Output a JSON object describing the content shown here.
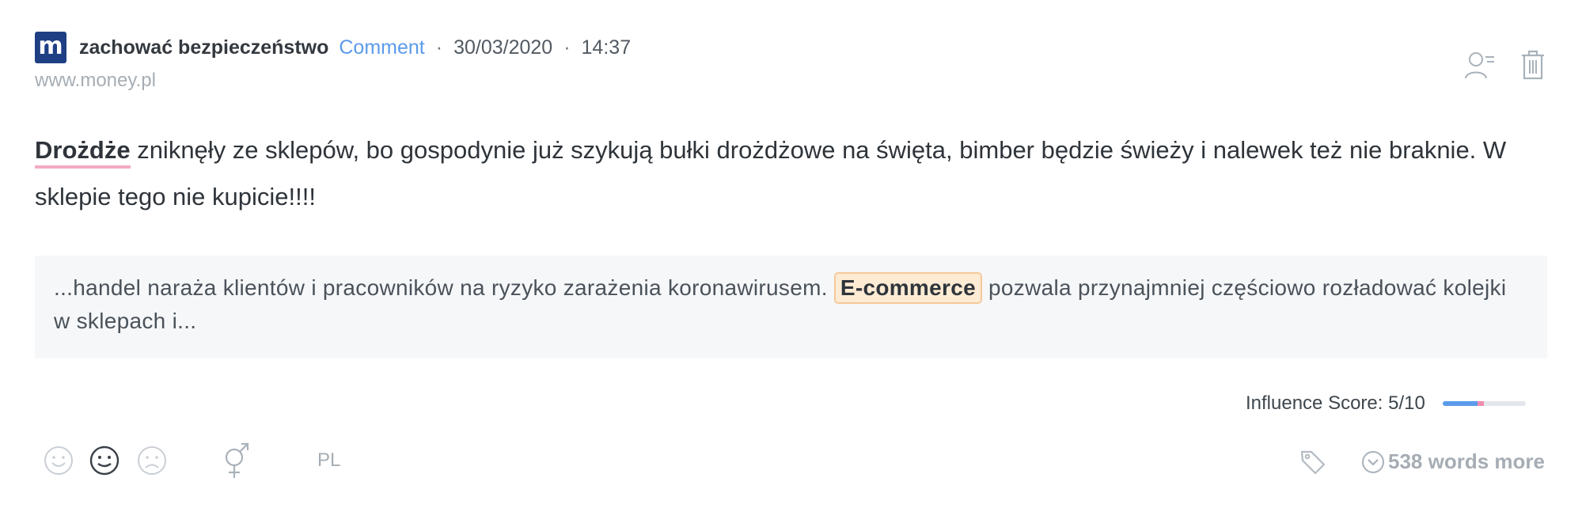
{
  "mention": {
    "logo_letter": "m",
    "author": "zachować bezpieczeństwo",
    "type": "Comment",
    "separator": "·",
    "date": "30/03/2020",
    "time": "14:37",
    "source": "www.money.pl"
  },
  "content": {
    "keyword": "Drożdże",
    "text": " zniknęły ze sklepów, bo gospodynie już szykują bułki drożdżowe na święta, bimber będzie świeży i nalewek też nie braknie. W sklepie tego nie kupicie!!!!"
  },
  "snippet": {
    "before": "...handel naraża klientów i pracowników na ryzyko zarażenia koronawirusem. ",
    "highlight": "E-commerce",
    "after": " pozwala przynajmniej częściowo rozładować kolejki w sklepach i..."
  },
  "influence": {
    "label": "Influence Score: 5/10",
    "score": 5,
    "max": 10
  },
  "footer": {
    "language": "PL",
    "selected_sentiment": "neutral",
    "more_label": "538 words more"
  },
  "colors": {
    "accent_blue": "#5b9bea",
    "keyword_underline": "#f2aac4",
    "highlight_bg": "#fdebd3",
    "highlight_border": "#f5c99a",
    "logo_bg": "#1f3f85"
  },
  "icons": [
    "source-logo-icon",
    "assign-user-icon",
    "trash-icon",
    "sentiment-positive-icon",
    "sentiment-neutral-icon",
    "sentiment-negative-icon",
    "gender-icon",
    "tag-icon",
    "expand-circle-icon"
  ]
}
